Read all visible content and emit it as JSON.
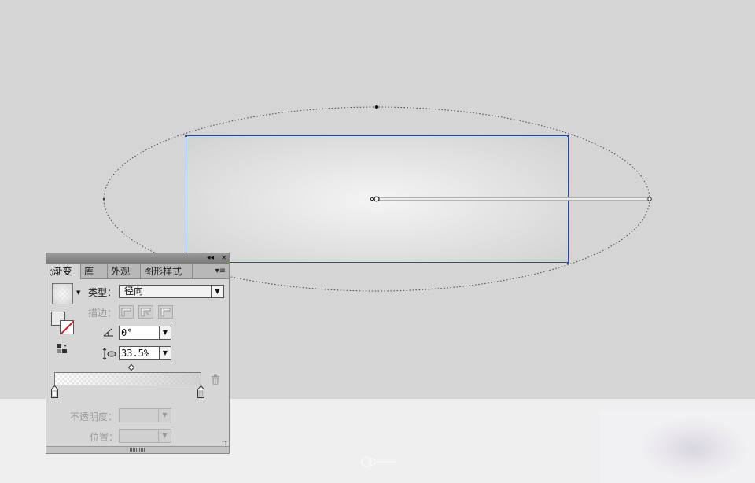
{
  "panel": {
    "tabs": [
      {
        "label": "渐变",
        "prefix": "◊"
      },
      {
        "label": "库"
      },
      {
        "label": "外观"
      },
      {
        "label": "图形样式"
      }
    ],
    "title_buttons": {
      "collapse": "◂◂",
      "close": "×"
    },
    "menu_icon": "▾≡",
    "type_label": "类型：",
    "type_value": "径向",
    "stroke_label": "描边：",
    "angle_value": "0°",
    "aspect_value": "33.5%",
    "opacity_label": "不透明度：",
    "location_label": "位置：",
    "dropdown_glyph": "▼"
  },
  "colors": {
    "bounding_box": "#2e4aa8",
    "canvas": "#d5d5d5",
    "pasteboard": "#f0eff0",
    "stroke_none": "#d02020"
  },
  "icons": [
    "gradient-swatch-icon",
    "fill-icon",
    "stroke-none-icon",
    "reverse-gradient-icon",
    "angle-icon",
    "aspect-ratio-icon",
    "midpoint-icon",
    "color-stop-icon",
    "trash-icon"
  ]
}
